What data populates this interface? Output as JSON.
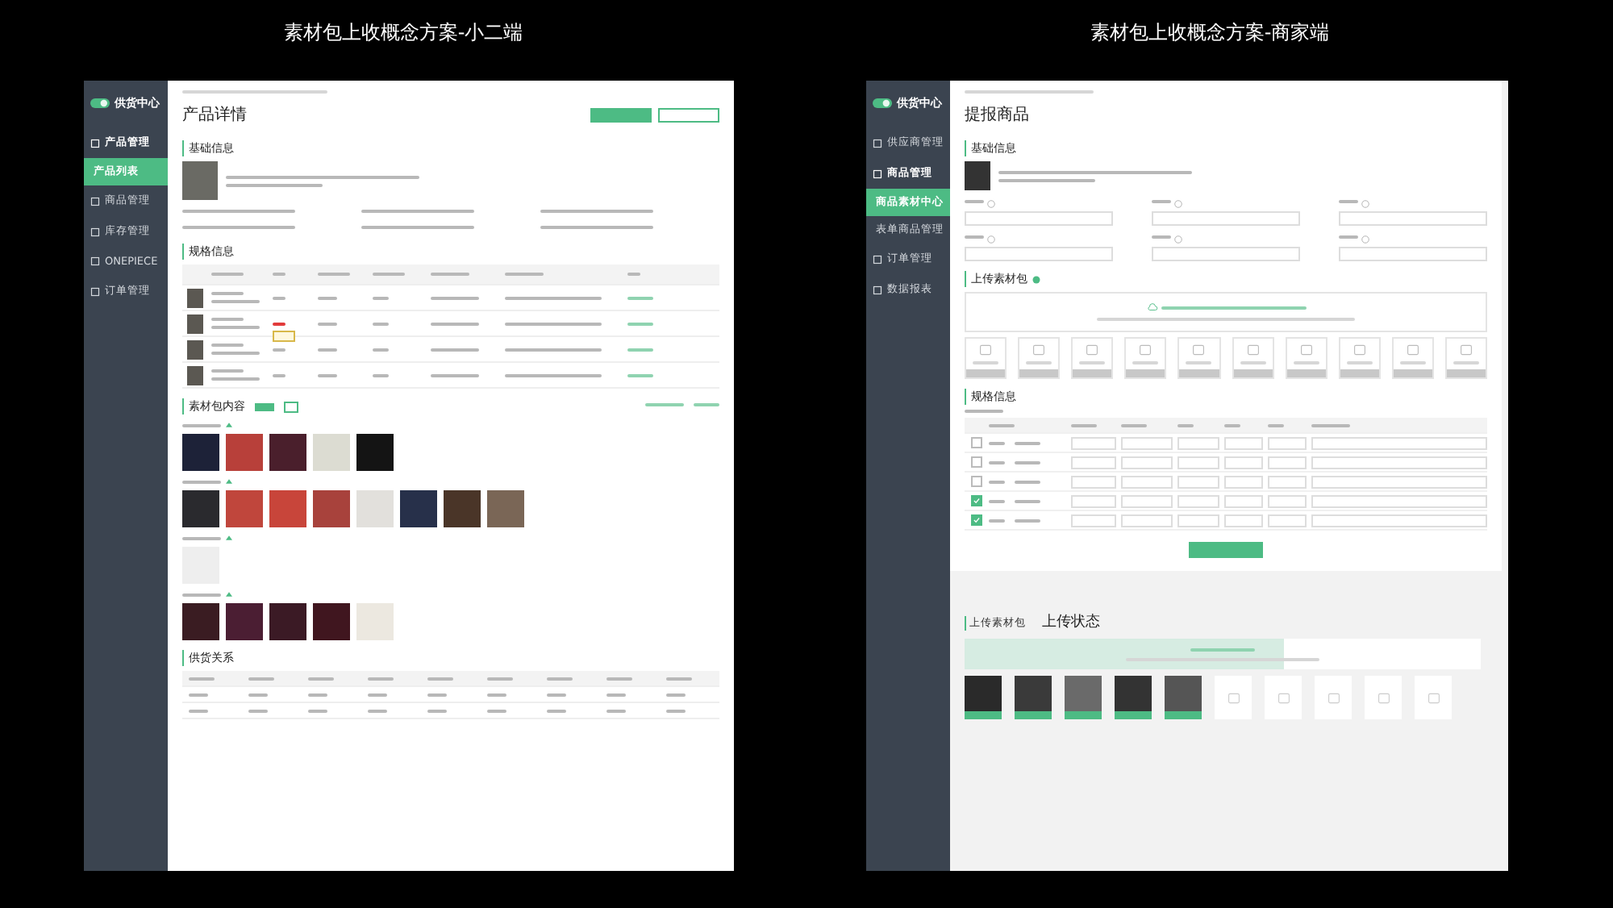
{
  "titles": [
    "素材包上收概念方案-小二端",
    "素材包上收概念方案-商家端"
  ],
  "admin": {
    "logo": {
      "title": "供货中心"
    },
    "nav": [
      {
        "label": "产品管理",
        "selected": false,
        "children": [
          {
            "label": "产品列表",
            "selected": true
          }
        ]
      },
      {
        "label": "商品管理",
        "selected": false
      },
      {
        "label": "库存管理",
        "selected": false
      },
      {
        "label": "ONEPIECE",
        "selected": false
      },
      {
        "label": "订单管理",
        "selected": false
      }
    ],
    "page_title": "产品详情",
    "basic_heading": "基础信息",
    "spec_heading": "规格信息",
    "sku_rows": [
      {
        "on_sale": true
      },
      {
        "on_sale": false
      },
      {
        "on_sale": true
      },
      {
        "on_sale": true
      }
    ],
    "material_heading": "素材包内容",
    "material_groups": [
      {
        "photos": [
          {
            "color": "#1d2238"
          },
          {
            "color": "#b8403a"
          },
          {
            "color": "#4a1f2c"
          },
          {
            "color": "#dcdcd2"
          },
          {
            "color": "#141414"
          }
        ]
      },
      {
        "photos": [
          {
            "color": "#2a2a2e"
          },
          {
            "color": "#c0463c"
          },
          {
            "color": "#c8453a"
          },
          {
            "color": "#a8423c"
          },
          {
            "color": "#e2e0dc"
          },
          {
            "color": "#27304a"
          },
          {
            "color": "#4a3528"
          },
          {
            "color": "#7a6656"
          }
        ]
      },
      {
        "photos": [
          {
            "color": "#eeeeee"
          }
        ]
      },
      {
        "photos": [
          {
            "color": "#3a1c22"
          },
          {
            "color": "#4b1e33"
          },
          {
            "color": "#3b1a25"
          },
          {
            "color": "#40161f"
          },
          {
            "color": "#ece8e0"
          }
        ]
      }
    ],
    "supply_heading": "供货关系"
  },
  "merchant": {
    "logo": {
      "title": "供货中心"
    },
    "nav": [
      {
        "label": "供应商管理",
        "selected": false
      },
      {
        "label": "商品管理",
        "selected": false,
        "children": [
          {
            "label": "商品素材中心",
            "selected": true
          },
          {
            "label": "表单商品管理",
            "selected": false
          }
        ]
      },
      {
        "label": "订单管理",
        "selected": false
      },
      {
        "label": "数据报表",
        "selected": false
      }
    ],
    "page_title": "提报商品",
    "basic_heading": "基础信息",
    "upload_heading": "上传素材包",
    "spec_heading": "规格信息",
    "sku_rows": [
      {
        "checked": false
      },
      {
        "checked": false
      },
      {
        "checked": false
      },
      {
        "checked": true
      },
      {
        "checked": true
      }
    ],
    "status": {
      "tab": "上传素材包",
      "title": "上传状态",
      "level": 0.62,
      "done": [
        {
          "color": "#2a2a2a"
        },
        {
          "color": "#3a3a3a"
        },
        {
          "color": "#6a6a6a"
        },
        {
          "color": "#333333"
        },
        {
          "color": "#555555"
        }
      ]
    }
  }
}
